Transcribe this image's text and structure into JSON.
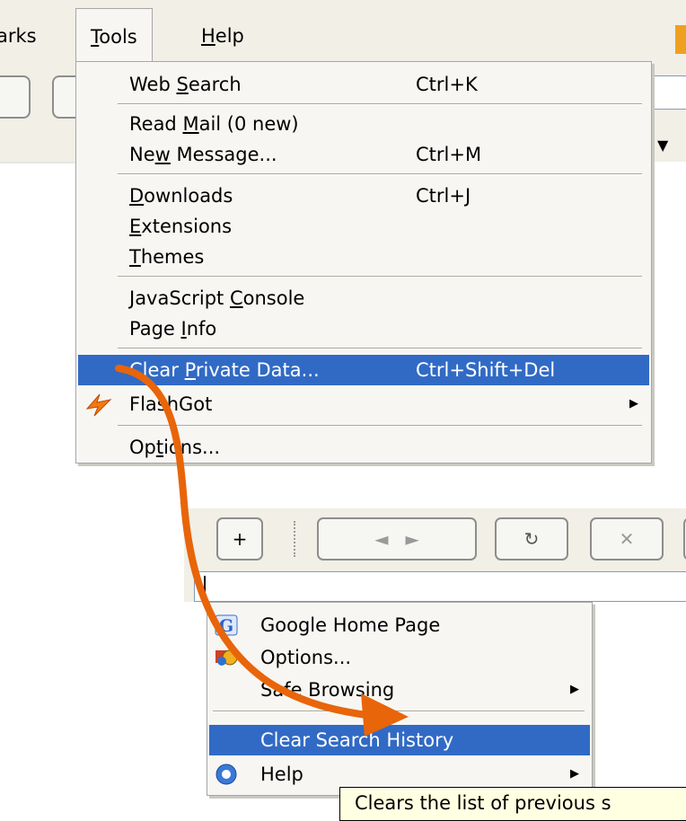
{
  "menubar": {
    "bookmarks_label": "arks",
    "tools_label": "Tools",
    "help_label": "Help"
  },
  "tools_menu": {
    "items": [
      {
        "label_pre": "Web ",
        "label_u": "S",
        "label_post": "earch",
        "shortcut": "Ctrl+K"
      },
      {
        "label_pre": "Read ",
        "label_u": "M",
        "label_post": "ail (0 new)",
        "shortcut": ""
      },
      {
        "label_pre": "Ne",
        "label_u": "w",
        "label_post": " Message...",
        "shortcut": "Ctrl+M"
      },
      {
        "label_pre": "",
        "label_u": "D",
        "label_post": "ownloads",
        "shortcut": "Ctrl+J"
      },
      {
        "label_pre": "",
        "label_u": "E",
        "label_post": "xtensions",
        "shortcut": ""
      },
      {
        "label_pre": "",
        "label_u": "T",
        "label_post": "hemes",
        "shortcut": ""
      },
      {
        "label_pre": "JavaScript ",
        "label_u": "C",
        "label_post": "onsole",
        "shortcut": ""
      },
      {
        "label_pre": "Page ",
        "label_u": "I",
        "label_post": "nfo",
        "shortcut": ""
      },
      {
        "label_pre": "Clear ",
        "label_u": "P",
        "label_post": "rivate Data...",
        "shortcut": "Ctrl+Shift+Del"
      },
      {
        "label_pre": "FlashGot",
        "label_u": "",
        "label_post": "",
        "shortcut": ""
      },
      {
        "label_pre": "Op",
        "label_u": "t",
        "label_post": "ions...",
        "shortcut": ""
      }
    ]
  },
  "google_toolbar": {
    "logo": "Google",
    "search_value": ""
  },
  "google_menu": {
    "items": [
      {
        "label": "Google Home Page"
      },
      {
        "label": "Options..."
      },
      {
        "label": "Safe Browsing"
      },
      {
        "label": "Clear Search History"
      },
      {
        "label": "Help"
      }
    ]
  },
  "tooltip": {
    "text": "Clears the list of previous s"
  },
  "colors": {
    "highlight": "#316ac5",
    "annotation_arrow": "#e8650a",
    "menu_bg": "#f7f6f3"
  }
}
